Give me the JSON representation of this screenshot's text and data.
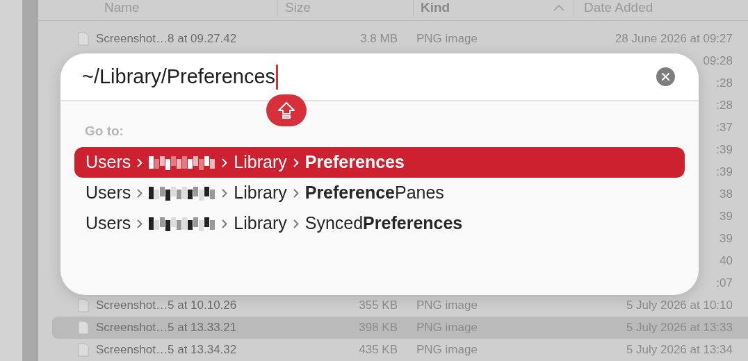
{
  "finder": {
    "columns": [
      {
        "label": "Name",
        "sorted": false
      },
      {
        "label": "Size",
        "sorted": false
      },
      {
        "label": "Kind",
        "sorted": true
      },
      {
        "label": "Date Added",
        "sorted": false
      }
    ],
    "rows": [
      {
        "name": "Screenshot…8 at 09.27.42",
        "size": "3.8 MB",
        "kind": "PNG image",
        "date": "28 June 2026 at 09:27",
        "selected": false
      },
      {
        "date": "09:28"
      },
      {
        "date": ":28"
      },
      {
        "date": ":28"
      },
      {
        "date": ":37"
      },
      {
        "date": ":39"
      },
      {
        "date": ":39"
      },
      {
        "date": "38"
      },
      {
        "date": "39"
      },
      {
        "date": "39"
      },
      {
        "date": "40"
      },
      {
        "date": ":07"
      },
      {
        "name": "Screenshot…5 at 10.10.26",
        "size": "355 KB",
        "kind": "PNG image",
        "date": "5 July 2026 at 10:10",
        "selected": false
      },
      {
        "name": "Screenshot…5 at 13.33.21",
        "size": "398 KB",
        "kind": "PNG image",
        "date": "5 July 2026 at 13:33",
        "selected": true
      },
      {
        "name": "Screenshot…5 at 13.34.32",
        "size": "435 KB",
        "kind": "PNG image",
        "date": "5 July 2026 at 13:34",
        "selected": false
      }
    ]
  },
  "go_dialog": {
    "path_value": "~/Library/Preferences",
    "caps_lock": true,
    "heading": "Go to:",
    "suggestions": [
      {
        "parts": [
          "Users",
          "Library",
          "**Preferences**"
        ],
        "selected": true
      },
      {
        "parts": [
          "Users",
          "Library",
          "**Preference**Panes"
        ],
        "selected": false
      },
      {
        "parts": [
          "Users",
          "Library",
          "Synced**Preferences**"
        ],
        "selected": false
      }
    ]
  }
}
